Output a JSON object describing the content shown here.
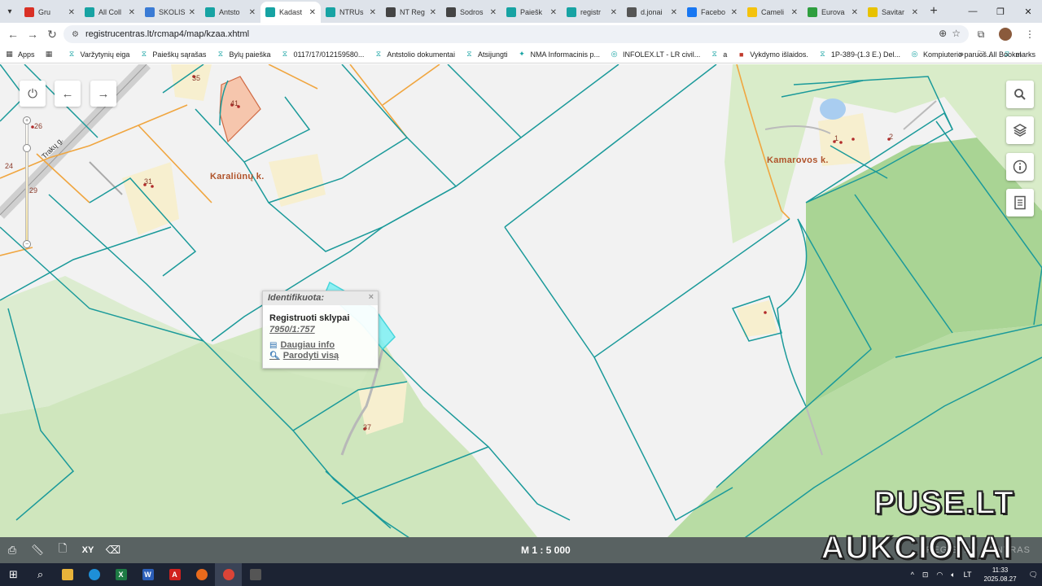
{
  "browser": {
    "tabs": [
      {
        "title": "Gru",
        "favicon": "gmail-icon",
        "color": "#d93025"
      },
      {
        "title": "All Coll",
        "favicon": "teal-icon",
        "color": "#17a3a3"
      },
      {
        "title": "SKOLIS",
        "favicon": "skolis-icon",
        "color": "#3a7bd5"
      },
      {
        "title": "Antsto",
        "favicon": "teal-icon",
        "color": "#17a3a3"
      },
      {
        "title": "Kadast",
        "favicon": "teal-icon",
        "color": "#17a3a3"
      },
      {
        "title": "NTRUs",
        "favicon": "teal-icon",
        "color": "#17a3a3"
      },
      {
        "title": "NT Reg",
        "favicon": "globe-icon",
        "color": "#444444"
      },
      {
        "title": "Sodros",
        "favicon": "globe-icon",
        "color": "#444444"
      },
      {
        "title": "Paiešk",
        "favicon": "teal-icon",
        "color": "#17a3a3"
      },
      {
        "title": "registr",
        "favicon": "teal-icon",
        "color": "#17a3a3"
      },
      {
        "title": "d.jonai",
        "favicon": "dots-icon",
        "color": "#555555"
      },
      {
        "title": "Facebo",
        "favicon": "facebook-icon",
        "color": "#1877f2"
      },
      {
        "title": "Cameli",
        "favicon": "camelia-icon",
        "color": "#f4c20d"
      },
      {
        "title": "Eurova",
        "favicon": "eurovaistine-icon",
        "color": "#2e9e3e"
      },
      {
        "title": "Savitar",
        "favicon": "savitarna-icon",
        "color": "#e8c200"
      }
    ],
    "active_tab_index": 4,
    "new_tab_label": "+",
    "url": "registrucentras.lt/rcmap4/map/kzaa.xhtml"
  },
  "bookmarks": {
    "items": [
      {
        "label": "Apps"
      },
      {
        "label": ""
      },
      {
        "label": "Varžytynių eiga"
      },
      {
        "label": "Paieškų sąrašas"
      },
      {
        "label": "Bylų paieška"
      },
      {
        "label": "0117/17/012159580..."
      },
      {
        "label": "Antstolio dokumentai"
      },
      {
        "label": "Atsijungti"
      },
      {
        "label": "NMA Informacinis p..."
      },
      {
        "label": "INFOLEX.LT - LR civil..."
      },
      {
        "label": "a"
      },
      {
        "label": "Vykdymo išlaidos."
      },
      {
        "label": "1P-389-(1.3 E.) Del..."
      },
      {
        "label": "Kompiuterio paruoš..."
      },
      {
        "label": "el"
      }
    ],
    "more": "»",
    "all_bookmarks": "All Bookmarks"
  },
  "map": {
    "village_labels": [
      "Karaliūnų k.",
      "Kamarovos k."
    ],
    "road_label": "Trakų g.",
    "house_numbers": [
      "35",
      "41",
      "31",
      "26",
      "24",
      "29",
      "37",
      "1",
      "2"
    ],
    "popup": {
      "header": "Identifikuota:",
      "close": "×",
      "title": "Registruoti sklypai",
      "parcel_id": "7950/1:757",
      "more_info": "Daugiau info",
      "show_all": "Parodyti visą"
    },
    "scale": "M 1 : 5 000",
    "brand_faint": "REGISTRŲ CENTRAS",
    "watermark_line1": "PUSE.LT",
    "watermark_line2": "AUKCIONAI"
  },
  "taskbar": {
    "language": "LT",
    "time": "11:33",
    "date": "2025.08.27"
  }
}
